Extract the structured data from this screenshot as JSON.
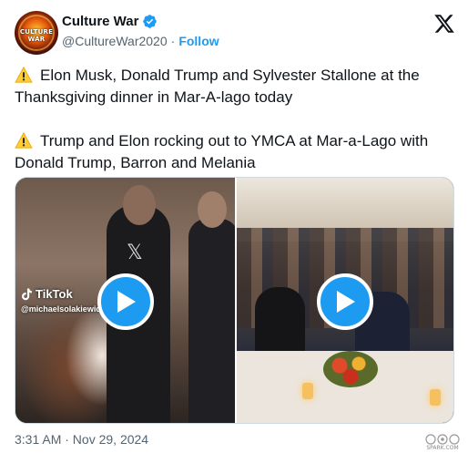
{
  "author": {
    "name": "Culture War",
    "handle": "@CultureWar2020",
    "separator": "·",
    "follow_label": "Follow",
    "avatar_text": "CULTURE WAR",
    "verified": true
  },
  "tweet": {
    "paragraph_1": "Elon Musk, Donald Trump and Sylvester Stallone at the Thanksgiving dinner in Mar-A-lago today",
    "paragraph_2": "Trump and Elon rocking out to YMCA at Mar-a-Lago with Donald Trump, Barron and Melania",
    "emoji_icon": "warning-icon"
  },
  "media": {
    "videos": [
      {
        "overlay_app": "TikTok",
        "overlay_handle": "@michaelsolakiewicz",
        "control": "play-button"
      },
      {
        "control": "play-button"
      }
    ]
  },
  "footer": {
    "timestamp": "3:31 AM · Nov 29, 2024",
    "watermark_text": "SPARK.COM"
  },
  "colors": {
    "accent": "#1d9bf0",
    "text_primary": "#0f1419",
    "text_secondary": "#536471",
    "border": "#cfd9de"
  }
}
